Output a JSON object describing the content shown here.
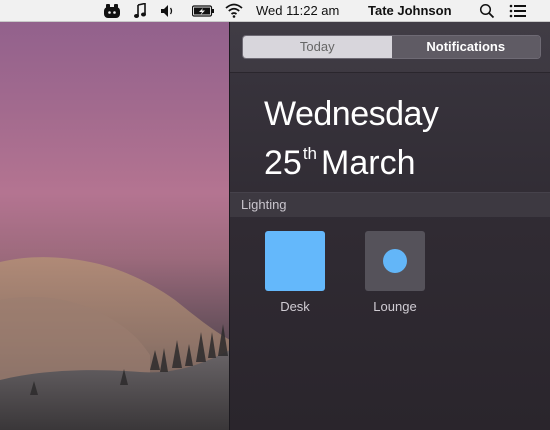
{
  "menubar": {
    "clock": "Wed 11:22 am",
    "user": "Tate Johnson",
    "icons": [
      "app-status-icon",
      "music-note-icon",
      "volume-icon",
      "battery-charging-icon",
      "wifi-icon",
      "spotlight-search-icon",
      "notification-center-icon"
    ]
  },
  "notification_center": {
    "tabs": [
      "Today",
      "Notifications"
    ],
    "active_tab": "Notifications",
    "date": {
      "weekday": "Wednesday",
      "day": "25",
      "ordinal": "th",
      "month": "March"
    },
    "section": {
      "title": "Lighting",
      "lights": [
        {
          "label": "Desk",
          "color": "#64b8fb"
        },
        {
          "label": "Lounge",
          "color": "#55525a"
        }
      ]
    }
  }
}
